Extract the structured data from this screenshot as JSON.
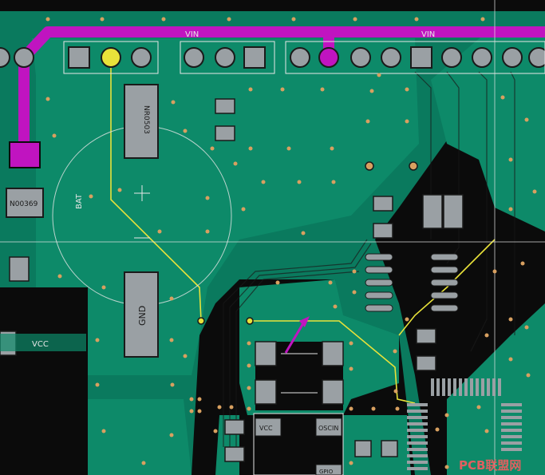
{
  "nets": {
    "top_net_left": "VIN",
    "top_net_right": "VIN",
    "vcc_left": "VCC"
  },
  "components": {
    "resistor_top": "NR0503",
    "resistor_left": "N00369",
    "gnd_pad": "GND",
    "battery_label": "BAT",
    "ic_pin_vcc": "VCC",
    "ic_pin_osc": "OSCIN",
    "ic_pin_misc": "GPIO"
  },
  "watermark": "PCB联盟网",
  "colors": {
    "board": "#0a7a5e",
    "copper_pour": "#0d8a69",
    "trace_magenta": "#c014c0",
    "trace_yellow": "#e8e23a",
    "pad_gray": "#9aa0a4",
    "via_orange": "#d8a060",
    "silkscreen": "#e6e6e6"
  }
}
